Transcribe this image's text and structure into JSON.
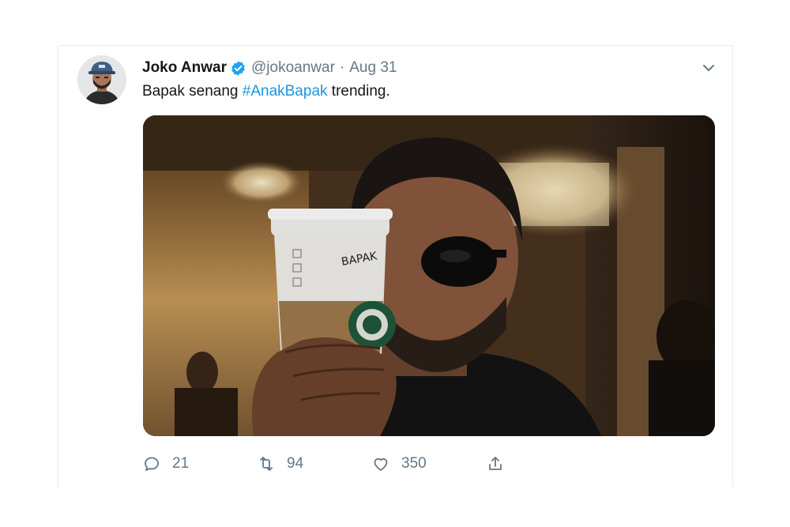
{
  "tweet": {
    "display_name": "Joko Anwar",
    "verified": true,
    "handle": "@jokoanwar",
    "separator": "·",
    "date": "Aug 31",
    "text_before": "Bapak senang ",
    "hashtag": "#AnakBapak",
    "text_after": " trending.",
    "cup_writing": "BAPAK"
  },
  "actions": {
    "replies": "21",
    "retweets": "94",
    "likes": "350"
  },
  "icons": {
    "verified": "verified-badge-icon",
    "caret": "chevron-down-icon",
    "reply": "reply-icon",
    "retweet": "retweet-icon",
    "like": "heart-icon",
    "share": "share-icon"
  },
  "colors": {
    "link": "#1b95e0",
    "muted": "#657786",
    "text": "#14171a"
  }
}
